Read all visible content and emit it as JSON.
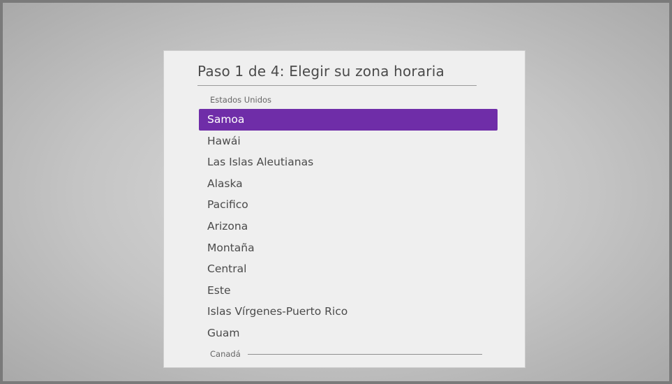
{
  "dialog": {
    "title": "Paso 1 de 4: Elegir su zona horaria"
  },
  "timezones": {
    "section_label": "Estados Unidos",
    "items": [
      {
        "label": "Samoa",
        "selected": true
      },
      {
        "label": "Hawái",
        "selected": false
      },
      {
        "label": "Las Islas Aleutianas",
        "selected": false
      },
      {
        "label": "Alaska",
        "selected": false
      },
      {
        "label": "Pacifico",
        "selected": false
      },
      {
        "label": "Arizona",
        "selected": false
      },
      {
        "label": "Montaña",
        "selected": false
      },
      {
        "label": "Central",
        "selected": false
      },
      {
        "label": "Este",
        "selected": false
      },
      {
        "label": "Islas Vírgenes-Puerto Rico",
        "selected": false
      },
      {
        "label": "Guam",
        "selected": false
      }
    ],
    "next_section_label": "Canadá"
  },
  "colors": {
    "highlight": "#6f2da8",
    "dialog_bg": "#efefef",
    "text": "#4a4a4a"
  }
}
